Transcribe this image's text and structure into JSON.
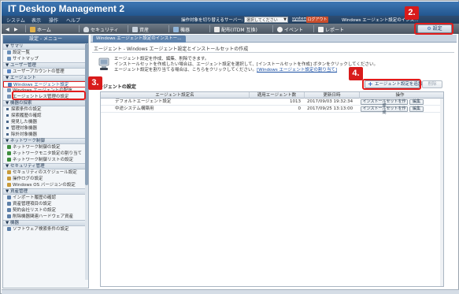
{
  "app": {
    "title": "IT Desktop Management 2"
  },
  "menubar": {
    "items": [
      "システム",
      "表示",
      "操作",
      "ヘルプ"
    ],
    "switch_label": "操作対象を切り替えるサーバー:",
    "switch_value": "選択してください",
    "system_link": "system",
    "logout_label": "ログアウト",
    "window_tab": "Windows エージェント設定のインス…"
  },
  "toolbar": {
    "back_label": "◀",
    "forward_label": "▶",
    "home_label": "ホーム",
    "security_label": "セキュリティ",
    "assets_label": "資産",
    "devices_label": "機器",
    "distribution_label": "配布(ITDM 互換)",
    "events_label": "イベント",
    "report_label": "レポート",
    "settings_label": "設定"
  },
  "callouts": {
    "step1": "2.",
    "step2": "3.",
    "step3": "4."
  },
  "sidebar": {
    "header": "設定 - メニュー",
    "sections": [
      {
        "label": "▼ サマリ",
        "items": [
          "設定一覧",
          "サイトマップ"
        ]
      },
      {
        "label": "▼ ユーザー管理",
        "items": [
          "ユーザーアカウントの管理"
        ]
      },
      {
        "label": "▼ エージェント",
        "items": [
          "Windows エージェント設定",
          "Windows エージェントの配信",
          "エージェントレス管理の設定"
        ]
      },
      {
        "label": "▼ 機器の探索",
        "items": [
          "探索条件の設定",
          "探索履歴の確認",
          "発見した機器",
          "管理対象機器",
          "除外対象機器"
        ]
      },
      {
        "label": "▼ ネットワーク制御",
        "items": [
          "ネットワーク制御の設定",
          "ネットワークモニタ設定の割り当て",
          "ネットワーク制御リストの設定"
        ]
      },
      {
        "label": "▼ セキュリティ管理",
        "items": [
          "セキュリティのスケジュール設定",
          "操作ログの設定",
          "Windows OS バージョンの設定"
        ]
      },
      {
        "label": "▼ 資産管理",
        "items": [
          "インポート履歴の確認",
          "資産管理項目の設定",
          "契約会社リストの設定",
          "削除機器関連ハードウェア資産"
        ]
      },
      {
        "label": "▼ 機器",
        "items": [
          "ソフトウェア検索条件の設定"
        ]
      }
    ]
  },
  "main": {
    "tab_label": "Windows エージェント設定のインストー…",
    "breadcrumb": "エージェント - Windows エージェント設定とインストールセットの作成",
    "info_line1": "エージェント設定を作成、編集、削除できます。",
    "info_line2": "インストールセットを作成したい場合は、エージェント設定を選択して、[インストールセットを作成] ボタンをクリックしてください。",
    "info_line3_prefix": "エージェント設定を割り当てる場合は、こちらをクリックしてください。",
    "info_link": "[Windows エージェント設定の割り当て]",
    "section_title": "エージェントの設定",
    "add_button": "エージェント設定を追加",
    "delete_button": "削除",
    "table": {
      "columns": [
        "エージェント設定名",
        "適用エージェント数",
        "更新日時",
        "操作"
      ],
      "rows": [
        {
          "name": "デフォルトエージェント設定",
          "count": "1013",
          "updated": "2017/09/03 19:32:34",
          "action1": "インストールセットを作成",
          "action2": "編集"
        },
        {
          "name": "中途システム構築用",
          "count": "0",
          "updated": "2017/09/25 13:13:00",
          "action1": "インストールセットを作成",
          "action2": "編集"
        }
      ]
    }
  }
}
